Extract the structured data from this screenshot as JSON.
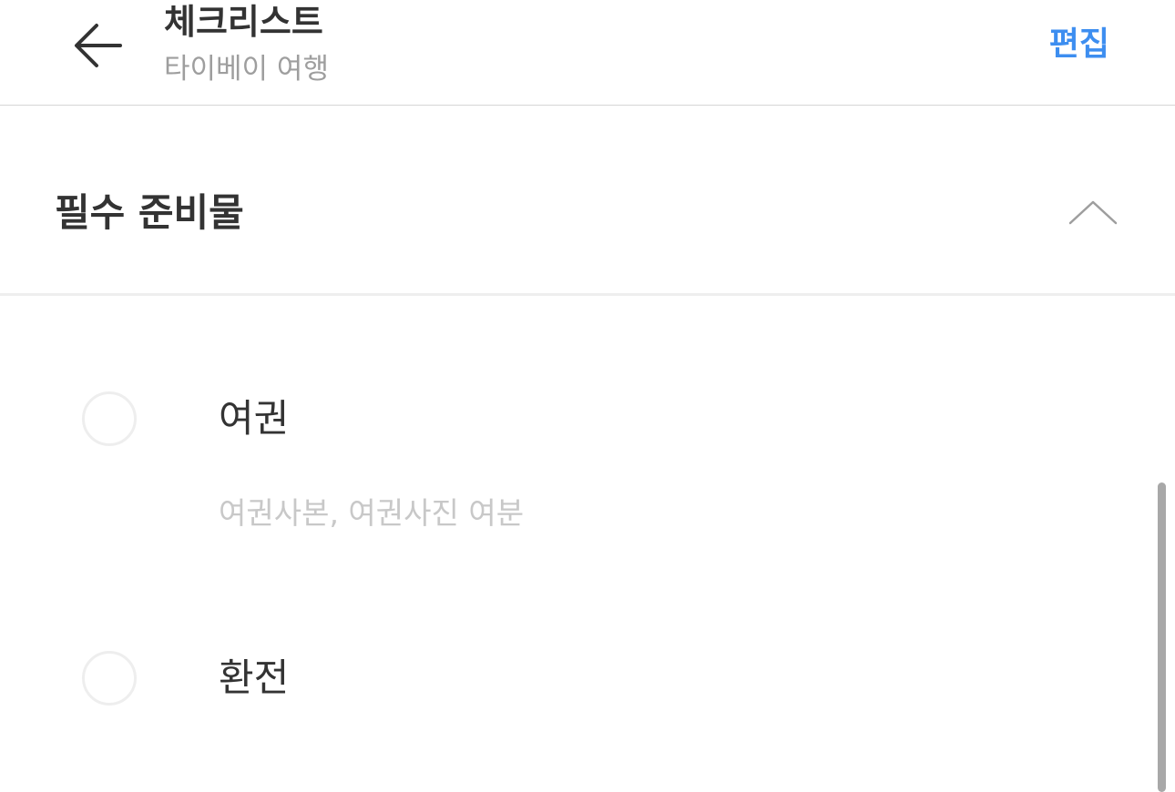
{
  "header": {
    "back_icon": "arrow-left-icon",
    "title": "체크리스트",
    "subtitle": "타이베이 여행",
    "edit_label": "편집",
    "accent_color": "#3d8ef0"
  },
  "section": {
    "title": "필수 준비물",
    "toggle_icon": "chevron-up-icon",
    "expanded": true
  },
  "items": [
    {
      "label": "여권",
      "note": "여권사본, 여권사진 여분",
      "checked": false
    },
    {
      "label": "환전",
      "note": "",
      "checked": false
    }
  ]
}
